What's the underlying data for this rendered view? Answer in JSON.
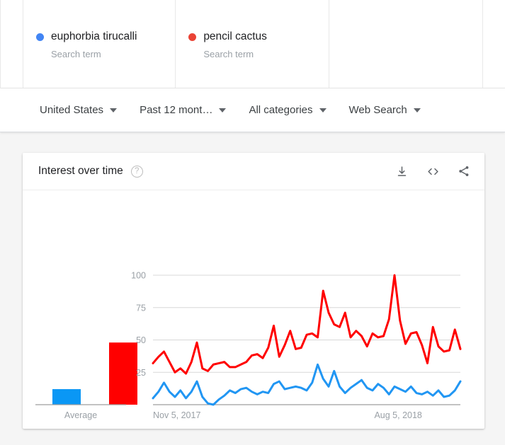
{
  "compare": {
    "terms": [
      {
        "label": "euphorbia tirucalli",
        "sub": "Search term",
        "color": "#4285f4",
        "dot": "legend-dot-blue"
      },
      {
        "label": "pencil cactus",
        "sub": "Search term",
        "color": "#ea4335",
        "dot": "legend-dot-red"
      }
    ]
  },
  "filters": [
    {
      "label": "United States"
    },
    {
      "label": "Past 12 mont…"
    },
    {
      "label": "All categories"
    },
    {
      "label": "Web Search"
    }
  ],
  "card": {
    "title": "Interest over time",
    "help_glyph": "?",
    "actions": [
      {
        "name": "download-icon",
        "label": "Download"
      },
      {
        "name": "embed-icon",
        "label": "Embed"
      },
      {
        "name": "share-icon",
        "label": "Share"
      }
    ]
  },
  "chart_data": {
    "type": "line",
    "title": "Interest over time",
    "xlabel": "",
    "ylabel": "",
    "ylim": [
      0,
      100
    ],
    "yticks": [
      25,
      50,
      75,
      100
    ],
    "grid": true,
    "legend_position": "top",
    "x_tick_labels": [
      "Nov 5, 2017",
      "Aug 5, 2018"
    ],
    "x_tick_positions": [
      0,
      0.72
    ],
    "series": [
      {
        "name": "euphorbia tirucalli",
        "color": "#2196f3",
        "values": [
          5,
          10,
          17,
          10,
          6,
          11,
          5,
          10,
          18,
          6,
          1,
          0,
          4,
          7,
          11,
          9,
          12,
          13,
          10,
          8,
          10,
          9,
          16,
          18,
          12,
          13,
          14,
          13,
          11,
          17,
          31,
          20,
          14,
          26,
          14,
          9,
          13,
          16,
          19,
          13,
          11,
          16,
          13,
          8,
          14,
          12,
          10,
          14,
          9,
          8,
          10,
          7,
          11,
          6,
          7,
          11,
          18
        ]
      },
      {
        "name": "pencil cactus",
        "color": "#ff0000",
        "values": [
          32,
          37,
          41,
          33,
          25,
          28,
          24,
          33,
          48,
          28,
          26,
          31,
          32,
          33,
          29,
          29,
          31,
          33,
          38,
          39,
          36,
          44,
          61,
          37,
          46,
          57,
          43,
          44,
          54,
          55,
          52,
          88,
          71,
          62,
          60,
          71,
          52,
          57,
          53,
          45,
          55,
          52,
          53,
          66,
          100,
          65,
          47,
          55,
          56,
          46,
          32,
          60,
          45,
          41,
          42,
          58,
          43
        ]
      }
    ],
    "average_bars": {
      "label": "Average",
      "categories": [
        "euphorbia tirucalli",
        "pencil cactus"
      ],
      "values": [
        12,
        48
      ],
      "colors": [
        "#0a97f5",
        "#ff0000"
      ]
    }
  }
}
